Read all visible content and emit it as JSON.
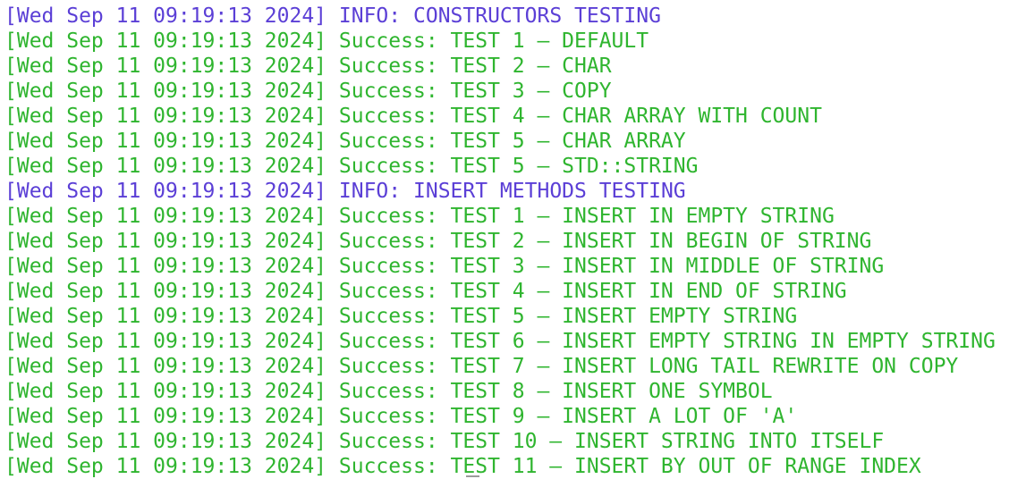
{
  "terminal": {
    "colors": {
      "background": "#ffffff",
      "info": "#5b3fd6",
      "success": "#2fb52f",
      "cursor": "#9a9a9a"
    },
    "lines": [
      {
        "type": "info",
        "timestamp": "[Wed Sep 11 09:19:13 2024]",
        "level": "INFO:",
        "message": "CONSTRUCTORS TESTING"
      },
      {
        "type": "success",
        "timestamp": "[Wed Sep 11 09:19:13 2024]",
        "level": "Success:",
        "message": "TEST 1 – DEFAULT"
      },
      {
        "type": "success",
        "timestamp": "[Wed Sep 11 09:19:13 2024]",
        "level": "Success:",
        "message": "TEST 2 – CHAR"
      },
      {
        "type": "success",
        "timestamp": "[Wed Sep 11 09:19:13 2024]",
        "level": "Success:",
        "message": "TEST 3 – COPY"
      },
      {
        "type": "success",
        "timestamp": "[Wed Sep 11 09:19:13 2024]",
        "level": "Success:",
        "message": "TEST 4 – CHAR ARRAY WITH COUNT"
      },
      {
        "type": "success",
        "timestamp": "[Wed Sep 11 09:19:13 2024]",
        "level": "Success:",
        "message": "TEST 5 – CHAR ARRAY"
      },
      {
        "type": "success",
        "timestamp": "[Wed Sep 11 09:19:13 2024]",
        "level": "Success:",
        "message": "TEST 5 – STD::STRING"
      },
      {
        "type": "info",
        "timestamp": "[Wed Sep 11 09:19:13 2024]",
        "level": "INFO:",
        "message": "INSERT METHODS TESTING"
      },
      {
        "type": "success",
        "timestamp": "[Wed Sep 11 09:19:13 2024]",
        "level": "Success:",
        "message": "TEST 1 – INSERT IN EMPTY STRING"
      },
      {
        "type": "success",
        "timestamp": "[Wed Sep 11 09:19:13 2024]",
        "level": "Success:",
        "message": "TEST 2 – INSERT IN BEGIN OF STRING"
      },
      {
        "type": "success",
        "timestamp": "[Wed Sep 11 09:19:13 2024]",
        "level": "Success:",
        "message": "TEST 3 – INSERT IN MIDDLE OF STRING"
      },
      {
        "type": "success",
        "timestamp": "[Wed Sep 11 09:19:13 2024]",
        "level": "Success:",
        "message": "TEST 4 – INSERT IN END OF STRING"
      },
      {
        "type": "success",
        "timestamp": "[Wed Sep 11 09:19:13 2024]",
        "level": "Success:",
        "message": "TEST 5 – INSERT EMPTY STRING"
      },
      {
        "type": "success",
        "timestamp": "[Wed Sep 11 09:19:13 2024]",
        "level": "Success:",
        "message": "TEST 6 – INSERT EMPTY STRING IN EMPTY STRING"
      },
      {
        "type": "success",
        "timestamp": "[Wed Sep 11 09:19:13 2024]",
        "level": "Success:",
        "message": "TEST 7 – INSERT LONG TAIL REWRITE ON COPY"
      },
      {
        "type": "success",
        "timestamp": "[Wed Sep 11 09:19:13 2024]",
        "level": "Success:",
        "message": "TEST 8 – INSERT ONE SYMBOL"
      },
      {
        "type": "success",
        "timestamp": "[Wed Sep 11 09:19:13 2024]",
        "level": "Success:",
        "message": "TEST 9 – INSERT A LOT OF 'A'"
      },
      {
        "type": "success",
        "timestamp": "[Wed Sep 11 09:19:13 2024]",
        "level": "Success:",
        "message": "TEST 10 – INSERT STRING INTO ITSELF"
      },
      {
        "type": "success",
        "timestamp": "[Wed Sep 11 09:19:13 2024]",
        "level": "Success:",
        "message": "TEST 11 – INSERT BY OUT OF RANGE INDEX"
      }
    ]
  }
}
